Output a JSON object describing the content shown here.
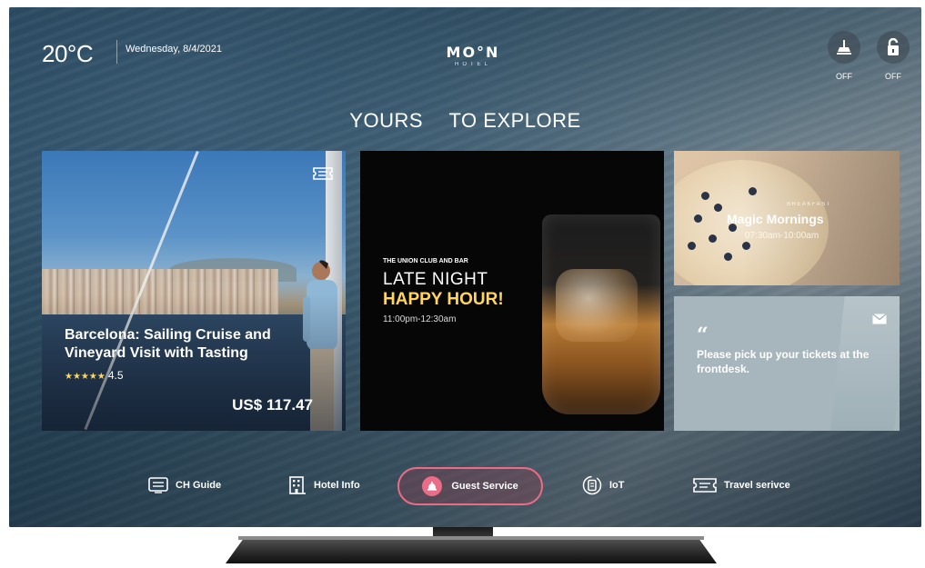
{
  "header": {
    "temperature": "20°C",
    "date": "Wednesday, 8/4/2021",
    "logo_main": "MO°N",
    "logo_sub": "HOTEL",
    "status": [
      {
        "icon": "do-not-disturb-icon",
        "label": "OFF"
      },
      {
        "icon": "lock-icon",
        "label": "OFF"
      }
    ]
  },
  "tabs": [
    {
      "label": "YOURS"
    },
    {
      "label": "TO EXPLORE"
    }
  ],
  "cards": {
    "sailing": {
      "title": "Barcelona: Sailing Cruise and Vineyard Visit with Tasting",
      "stars": "★★★★★",
      "rating": "4.5",
      "price": "US$ 117.47",
      "icon": "ticket-icon"
    },
    "happy_hour": {
      "venue": "THE UNION CLUB AND BAR",
      "line1": "LATE NIGHT",
      "line2": "HAPPY HOUR!",
      "time": "11:00pm-12:30am",
      "accent": "#ffd55a"
    },
    "breakfast": {
      "tag": "BREAKFAST",
      "title": "Magic Mornings",
      "time": "07:30am-10:00am"
    },
    "message": {
      "quote": "“",
      "text": "Please pick up your tickets at the frontdesk.",
      "icon": "envelope-icon"
    }
  },
  "nav": {
    "items": [
      {
        "label": "CH Guide",
        "icon": "tv-guide-icon"
      },
      {
        "label": "Hotel Info",
        "icon": "building-icon"
      },
      {
        "label": "Guest Service",
        "icon": "bell-icon",
        "active": true
      },
      {
        "label": "IoT",
        "icon": "device-icon"
      },
      {
        "label": "Travel serivce",
        "icon": "ticket-icon"
      }
    ],
    "active_color": "#ea6c86"
  }
}
